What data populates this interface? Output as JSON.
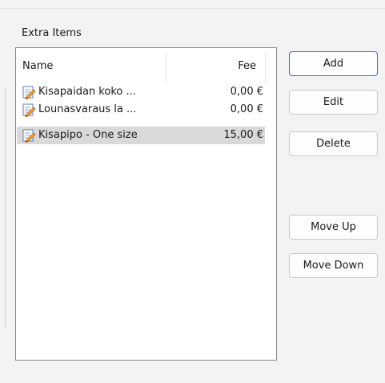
{
  "group": {
    "title": "Extra Items"
  },
  "list": {
    "columns": {
      "name": "Name",
      "fee": "Fee"
    },
    "rows": [
      {
        "name": "Kisapaidan koko ...",
        "fee": "0,00 €",
        "icon": "edit-document-icon",
        "selected": false
      },
      {
        "name": "Lounasvaraus la ...",
        "fee": "0,00 €",
        "icon": "edit-document-icon",
        "selected": false
      },
      {
        "name": "Kisapipo - One size",
        "fee": "15,00 €",
        "icon": "edit-document-icon",
        "selected": true
      }
    ]
  },
  "buttons": {
    "add": "Add",
    "edit": "Edit",
    "delete": "Delete",
    "move_up": "Move Up",
    "move_down": "Move Down"
  },
  "colors": {
    "default_button_border": "#2d6fd6",
    "selected_row": "#d9d9d9"
  }
}
